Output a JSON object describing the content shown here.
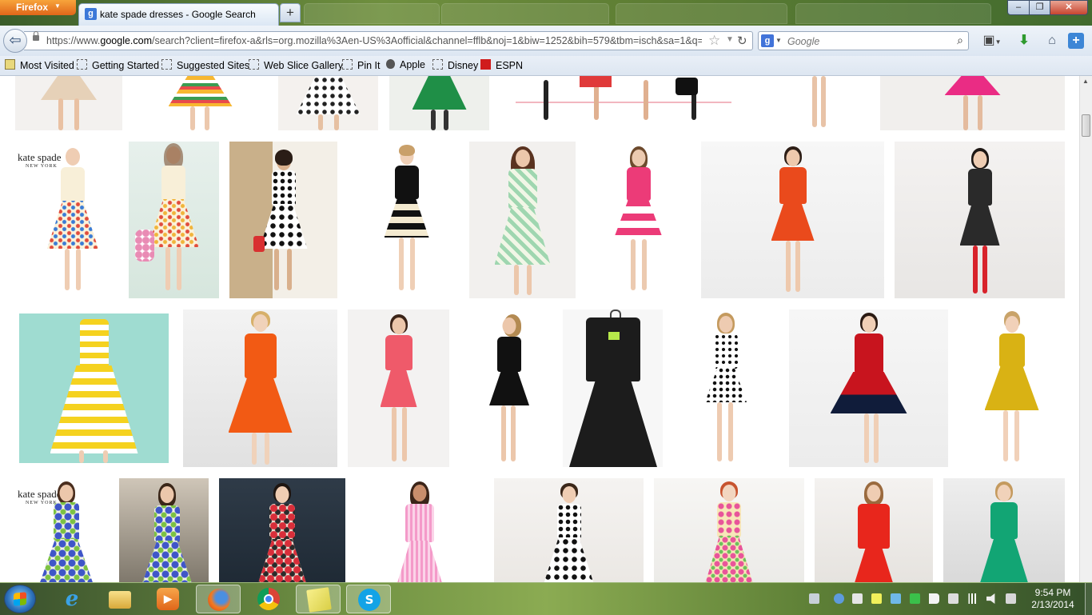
{
  "browser": {
    "menu_button": "Firefox",
    "active_tab_title": "kate spade dresses - Google Search",
    "new_tab_symbol": "+",
    "close_symbol": "✕",
    "window_buttons": {
      "minimize": "–",
      "maximize": "❐",
      "close": "✕"
    }
  },
  "navbar": {
    "url_prefix": "https://www.",
    "url_domain": "google.com",
    "url_rest": "/search?client=firefox-a&rls=org.mozilla%3Aen-US%3Aofficial&channel=fflb&noj=1&biw=1252&bih=579&tbm=isch&sa=1&q=l",
    "search_placeholder": "Google"
  },
  "bookmarks": [
    "Most Visited",
    "Getting Started",
    "Suggested Sites",
    "Web Slice Gallery",
    "Pin It",
    "Apple",
    "Disney",
    "ESPN"
  ],
  "brand_labels": {
    "name": "kate spade",
    "sub": "NEW YORK"
  },
  "taskbar": {
    "time": "9:54 PM",
    "date": "2/13/2014"
  }
}
